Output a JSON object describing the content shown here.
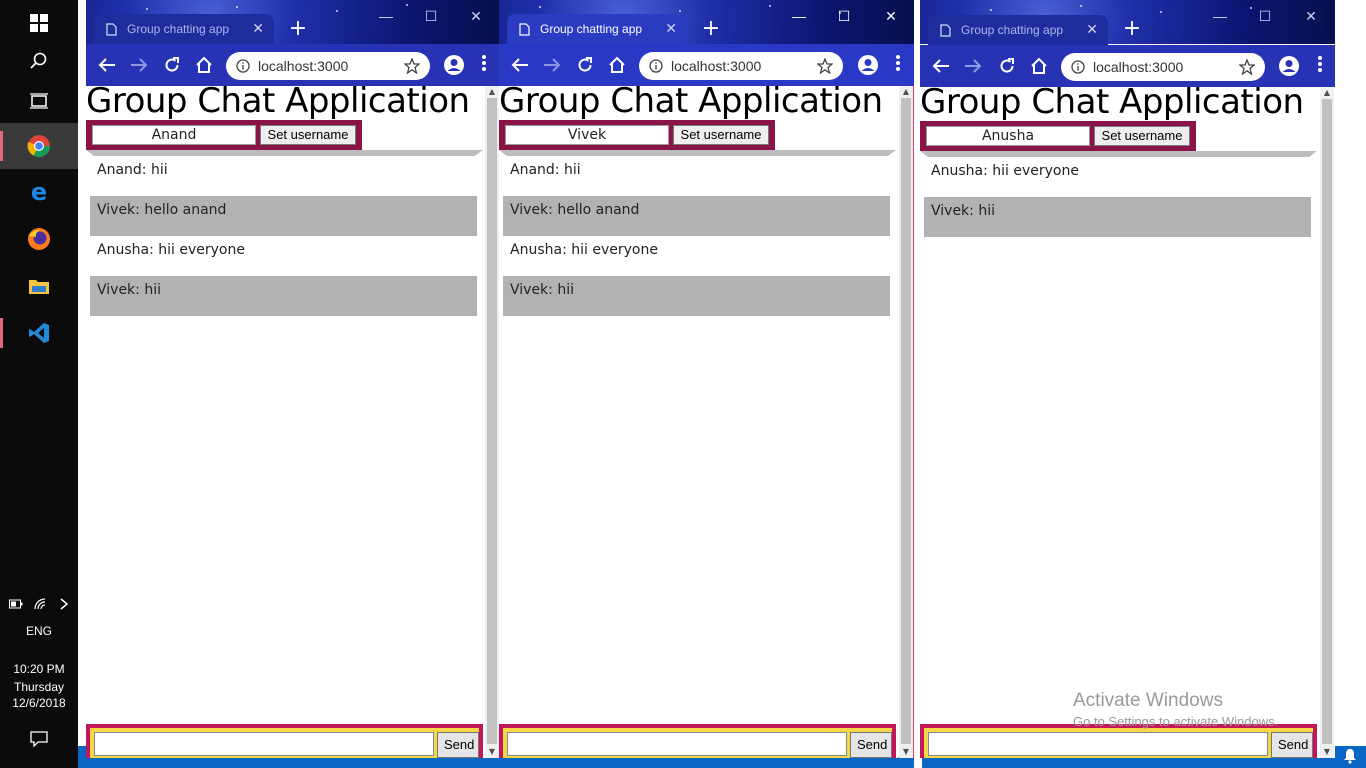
{
  "taskbar": {
    "language": "ENG",
    "time": "10:20 PM",
    "day": "Thursday",
    "date": "12/6/2018",
    "apps": [
      "windows-start",
      "search",
      "task-view",
      "chrome",
      "edge",
      "firefox",
      "file-explorer",
      "vscode"
    ]
  },
  "watermark": {
    "line1": "Activate Windows",
    "line2": "Go to Settings to activate Windows."
  },
  "windows": [
    {
      "tab_title": "Group chatting app",
      "url": "localhost:3000",
      "page_title": "Group Chat Application",
      "username_value": "Anand",
      "set_username_label": "Set username",
      "send_label": "Send",
      "messages": [
        "Anand: hii",
        "Vivek: hello anand",
        "Anusha: hii everyone",
        "Vivek: hii"
      ]
    },
    {
      "tab_title": "Group chatting app",
      "url": "localhost:3000",
      "page_title": "Group Chat Application",
      "username_value": "Vivek",
      "set_username_label": "Set username",
      "send_label": "Send",
      "messages": [
        "Anand: hii",
        "Vivek: hello anand",
        "Anusha: hii everyone",
        "Vivek: hii"
      ]
    },
    {
      "tab_title": "Group chatting app",
      "url": "localhost:3000",
      "page_title": "Group Chat Application",
      "username_value": "Anusha",
      "set_username_label": "Set username",
      "send_label": "Send",
      "messages": [
        "Anusha: hii everyone",
        "Vivek: hii"
      ]
    }
  ],
  "colors": {
    "userbar": "#8a1447",
    "composer_border": "#c2185b",
    "composer_fill": "#f4d84a",
    "alt_message": "#b2b2b2",
    "titlebar": "#0b1570"
  }
}
